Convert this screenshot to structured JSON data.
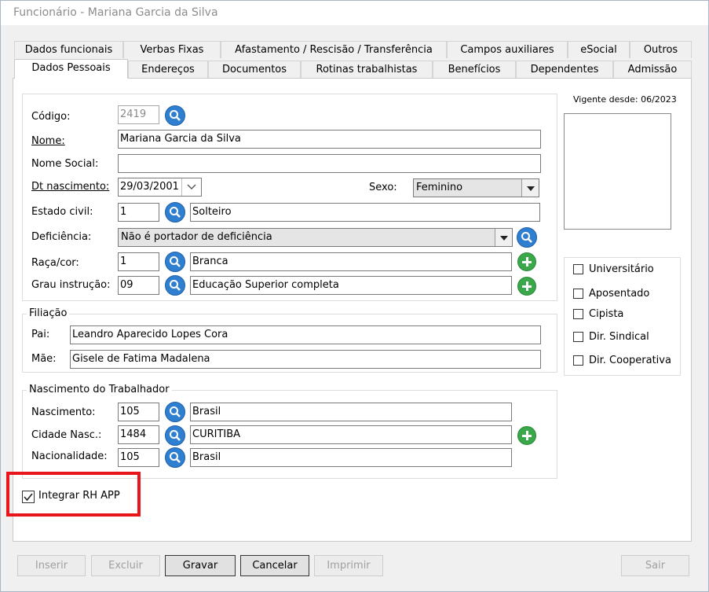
{
  "window": {
    "title": "Funcionário - Mariana Garcia da Silva"
  },
  "tabs_row1": [
    "Dados funcionais",
    "Verbas Fixas",
    "Afastamento / Rescisão / Transferência",
    "Campos auxiliares",
    "eSocial",
    "Outros"
  ],
  "tabs_row2": [
    "Dados Pessoais",
    "Endereços",
    "Documentos",
    "Rotinas trabalhistas",
    "Benefícios",
    "Dependentes",
    "Admissão"
  ],
  "active_tab": "Dados Pessoais",
  "personal": {
    "codigo_label": "Código:",
    "codigo_value": "2419",
    "nome_label": "Nome:",
    "nome_value": "Mariana Garcia da Silva",
    "nome_social_label": "Nome Social:",
    "nome_social_value": "",
    "dt_nasc_label": "Dt nascimento:",
    "dt_nasc_value": "29/03/2001",
    "sexo_label": "Sexo:",
    "sexo_value": "Feminino",
    "estado_civil_label": "Estado civil:",
    "estado_civil_code": "1",
    "estado_civil_desc": "Solteiro",
    "deficiencia_label": "Deficiência:",
    "deficiencia_value": "Não é portador de deficiência",
    "raca_label": "Raça/cor:",
    "raca_code": "1",
    "raca_desc": "Branca",
    "grau_label": "Grau instrução:",
    "grau_code": "09",
    "grau_desc": "Educação Superior completa"
  },
  "filiacao": {
    "legend": "Filiação",
    "pai_label": "Pai:",
    "pai_value": "Leandro Aparecido Lopes Cora",
    "mae_label": "Mãe:",
    "mae_value": "Gisele de Fatima Madalena"
  },
  "nascimento": {
    "legend": "Nascimento do Trabalhador",
    "nasc_label": "Nascimento:",
    "nasc_code": "105",
    "nasc_desc": "Brasil",
    "cidade_label": "Cidade Nasc.:",
    "cidade_code": "1484",
    "cidade_desc": "CURITIBA",
    "nac_label": "Nacionalidade:",
    "nac_code": "105",
    "nac_desc": "Brasil"
  },
  "photo": {
    "vigente_label": "Vigente desde: 06/2023"
  },
  "flags": [
    {
      "label": "Universitário",
      "checked": false
    },
    {
      "label": "Aposentado",
      "checked": false
    },
    {
      "label": "Cipista",
      "checked": false
    },
    {
      "label": "Dir. Sindical",
      "checked": false
    },
    {
      "label": "Dir. Cooperativa",
      "checked": false
    }
  ],
  "integrar": {
    "label": "Integrar RH APP",
    "checked": true,
    "highlight_color": "#e8161b"
  },
  "buttons": {
    "inserir": "Inserir",
    "excluir": "Excluir",
    "gravar": "Gravar",
    "cancelar": "Cancelar",
    "imprimir": "Imprimir",
    "sair": "Sair"
  },
  "colors": {
    "search_icon": "#2f7fd1",
    "add_icon": "#3aa84a"
  }
}
